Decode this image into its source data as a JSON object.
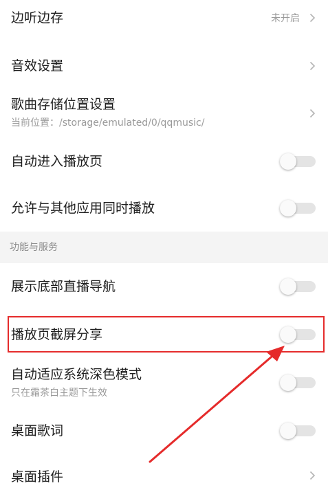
{
  "rows": [
    {
      "title": "边听边存",
      "value": "未开启",
      "control": "chevron"
    },
    {
      "title": "音效设置",
      "control": "chevron"
    },
    {
      "title": "歌曲存储位置设置",
      "subtitle": "当前位置：/storage/emulated/0/qqmusic/",
      "control": "chevron"
    },
    {
      "title": "自动进入播放页",
      "control": "toggle",
      "on": false
    },
    {
      "title": "允许与其他应用同时播放",
      "control": "toggle",
      "on": false
    }
  ],
  "section": {
    "label": "功能与服务"
  },
  "section_rows": [
    {
      "title": "展示底部直播导航",
      "control": "toggle",
      "on": false
    },
    {
      "title": "播放页截屏分享",
      "control": "toggle",
      "on": false
    },
    {
      "title": "自动适应系统深色模式",
      "subtitle": "只在霜茶白主题下生效",
      "control": "toggle",
      "on": false
    },
    {
      "title": "桌面歌词",
      "control": "toggle",
      "on": false
    },
    {
      "title": "桌面插件",
      "control": "chevron"
    }
  ],
  "colors": {
    "highlight": "#e52b2b",
    "toggle_track": "#e4e4e4",
    "section_bg": "#f4f4f4"
  }
}
